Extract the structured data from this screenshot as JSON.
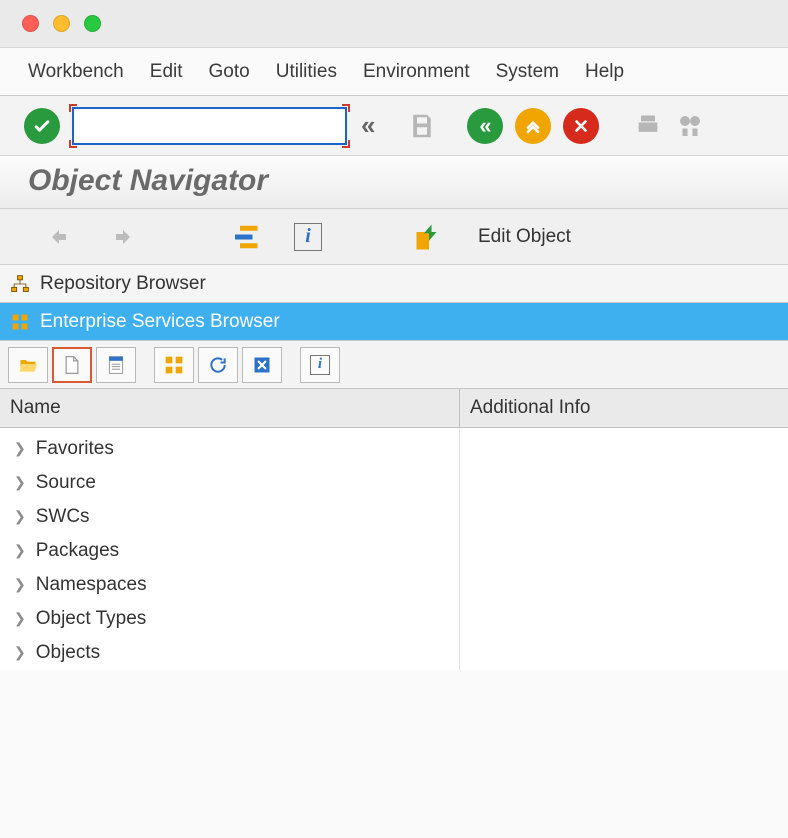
{
  "menubar": [
    "Workbench",
    "Edit",
    "Goto",
    "Utilities",
    "Environment",
    "System",
    "Help"
  ],
  "cmd_input": {
    "value": ""
  },
  "page_title": "Object Navigator",
  "navrow": {
    "edit_object": "Edit Object"
  },
  "browsers": {
    "repo": "Repository Browser",
    "esb": "Enterprise Services Browser"
  },
  "tree_columns": {
    "name": "Name",
    "info": "Additional Info"
  },
  "tree_items": [
    {
      "label": "Favorites"
    },
    {
      "label": "Source"
    },
    {
      "label": "SWCs"
    },
    {
      "label": "Packages"
    },
    {
      "label": "Namespaces"
    },
    {
      "label": "Object Types"
    },
    {
      "label": "Objects"
    }
  ]
}
